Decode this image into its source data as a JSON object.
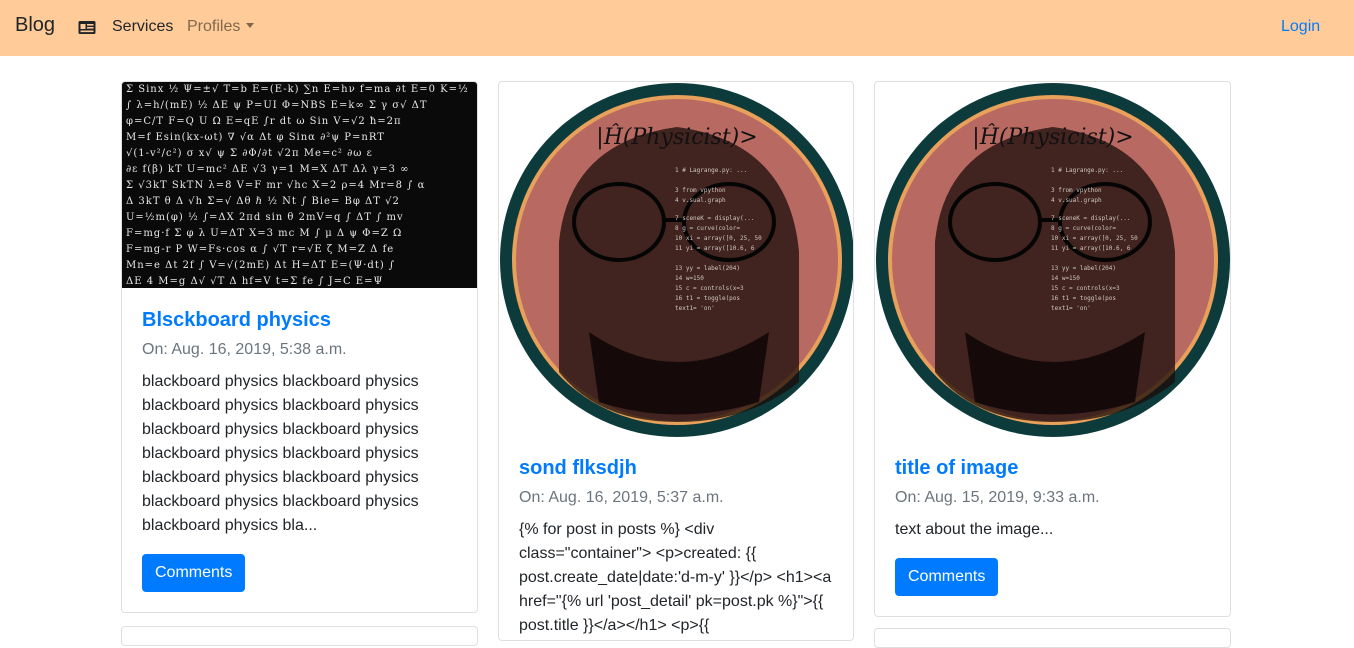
{
  "navbar": {
    "brand": "Blog",
    "icon": "id-card-icon",
    "services_label": "Services",
    "profiles_label": "Profiles",
    "login_label": "Login"
  },
  "posts": [
    {
      "title": "Blsckboard physics",
      "date": "On: Aug. 16, 2019, 5:38 a.m.",
      "text": "blackboard physics blackboard physics blackboard physics blackboard physics blackboard physics blackboard physics blackboard physics blackboard physics blackboard physics blackboard physics blackboard physics blackboard physics blackboard physics bla...",
      "button_label": "Comments",
      "image": "blackboard-equations"
    },
    {
      "title": "sond flksdjh",
      "date": "On: Aug. 16, 2019, 5:37 a.m.",
      "text": "{% for post in posts %} <div class=\"container\"> <p>created: {{ post.create_date|date:'d-m-y' }}</p> <h1><a href=\"{% url 'post_detail' pk=post.pk %}\">{{ post.title }}</a></h1> <p>{{",
      "image": "physicist-portrait"
    },
    {
      "title": "title of image",
      "date": "On: Aug. 15, 2019, 9:33 a.m.",
      "text": "text about the image...",
      "button_label": "Comments",
      "image": "physicist-portrait"
    }
  ],
  "portrait": {
    "heading": "|Ĥ(Physicist)>"
  },
  "colors": {
    "navbar": "#ffcc99",
    "accent": "#007bff",
    "portrait_ring": "#0d3a3a",
    "portrait_inner_ring": "#e8a05a",
    "portrait_bg": "#b86a62"
  }
}
